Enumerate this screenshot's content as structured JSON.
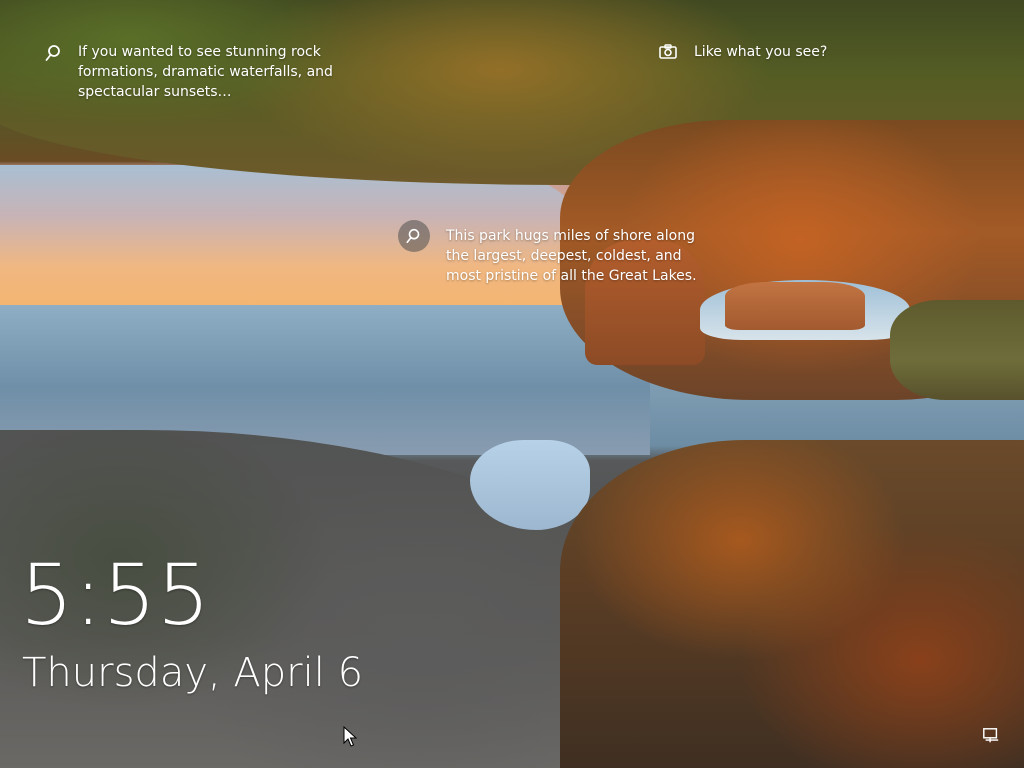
{
  "lock_screen": {
    "spotlight_top_text": "If you wanted to see stunning rock formations, dramatic waterfalls, and spectacular sunsets…",
    "like_what_you_see": "Like what you see?",
    "hotspot_text": "This park hugs miles of shore along the largest, deepest, coldest, and most pristine of all the Great Lakes.",
    "time": "5:55",
    "date": "Thursday, April 6"
  },
  "icons": {
    "search": "search-icon",
    "camera": "camera-icon",
    "hotspot": "hotspot-search-icon",
    "network": "network-icon",
    "cursor": "mouse-cursor-icon"
  },
  "colors": {
    "text": "#ffffff",
    "hotspot_bg": "rgba(80,80,80,0.55)"
  }
}
